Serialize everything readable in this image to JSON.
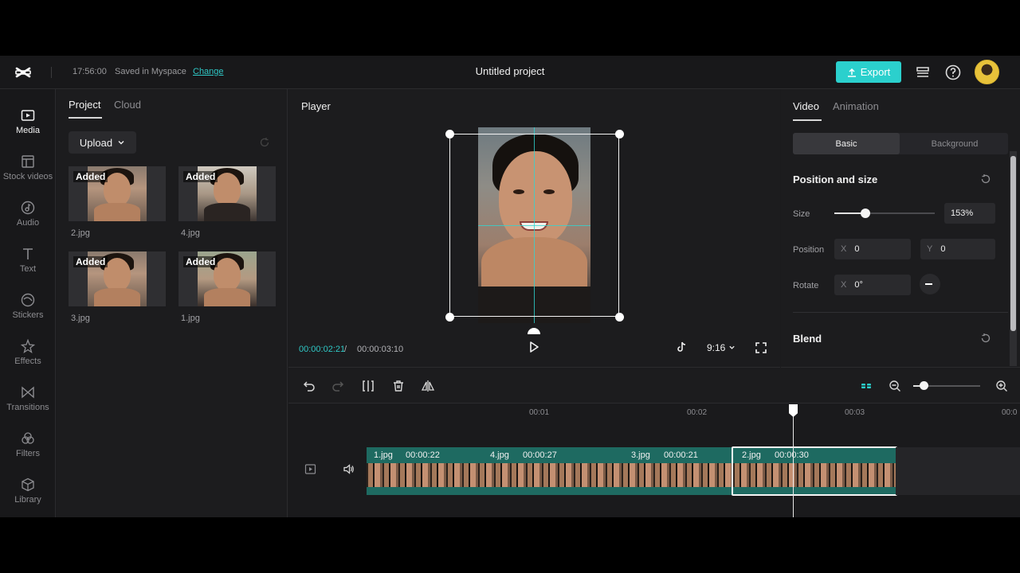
{
  "header": {
    "time": "17:56:00",
    "saved_text": "Saved in Myspace",
    "change_link": "Change",
    "project_title": "Untitled project",
    "export_label": "Export"
  },
  "rail": [
    {
      "label": "Media",
      "icon": "media-icon"
    },
    {
      "label": "Stock videos",
      "icon": "stock-videos-icon"
    },
    {
      "label": "Audio",
      "icon": "audio-icon"
    },
    {
      "label": "Text",
      "icon": "text-icon"
    },
    {
      "label": "Stickers",
      "icon": "stickers-icon"
    },
    {
      "label": "Effects",
      "icon": "effects-icon"
    },
    {
      "label": "Transitions",
      "icon": "transitions-icon"
    },
    {
      "label": "Filters",
      "icon": "filters-icon"
    },
    {
      "label": "Library",
      "icon": "library-icon"
    }
  ],
  "media": {
    "tabs": [
      "Project",
      "Cloud"
    ],
    "upload_label": "Upload",
    "items": [
      {
        "name": "2.jpg",
        "badge": "Added"
      },
      {
        "name": "4.jpg",
        "badge": "Added"
      },
      {
        "name": "3.jpg",
        "badge": "Added"
      },
      {
        "name": "1.jpg",
        "badge": "Added"
      }
    ]
  },
  "player": {
    "label": "Player",
    "current_time": "00:00:02:21",
    "separator": "/",
    "total_time": "00:00:03:10",
    "ratio": "9:16"
  },
  "props": {
    "tabs": [
      "Video",
      "Animation"
    ],
    "segments": [
      "Basic",
      "Background"
    ],
    "position_size_title": "Position and size",
    "size_label": "Size",
    "size_value": "153%",
    "size_slider_fraction": 0.31,
    "position_label": "Position",
    "pos_x_axis": "X",
    "pos_x": "0",
    "pos_y_axis": "Y",
    "pos_y": "0",
    "rotate_label": "Rotate",
    "rot_axis": "X",
    "rotate_value": "0°",
    "blend_title": "Blend"
  },
  "timeline": {
    "ticks": [
      "00:01",
      "00:02",
      "00:03",
      "00:0"
    ],
    "zoom_fraction": 0.16,
    "clips": [
      {
        "name": "1.jpg",
        "duration": "00:00:22"
      },
      {
        "name": "4.jpg",
        "duration": "00:00:27"
      },
      {
        "name": "3.jpg",
        "duration": "00:00:21"
      },
      {
        "name": "2.jpg",
        "duration": "00:00:30"
      }
    ]
  },
  "colors": {
    "accent": "#2bd0cd",
    "timecode": "#2fc7c5",
    "clip": "#1e6a61"
  }
}
